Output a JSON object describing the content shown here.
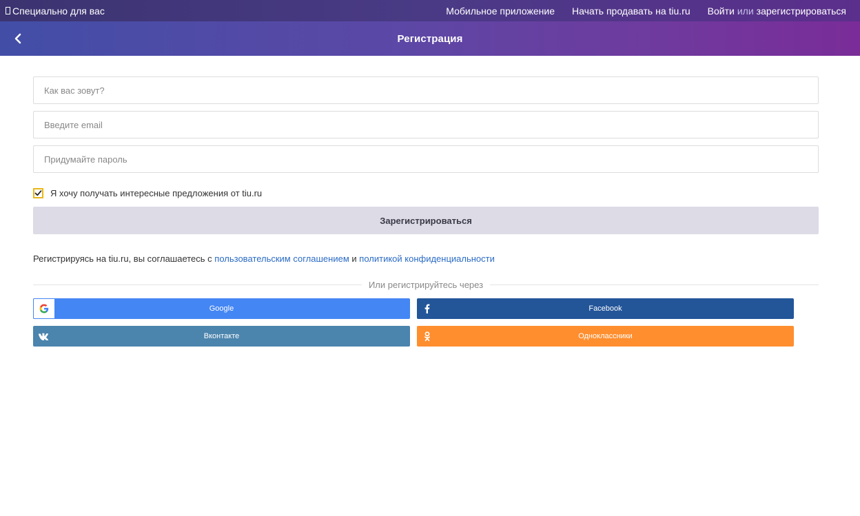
{
  "topbar": {
    "promo_label": "Специально для вас",
    "mobile_app": "Мобильное приложение",
    "start_selling": "Начать продавать на tiu.ru",
    "login": "Войти",
    "or": "или",
    "register": "зарегистрироваться"
  },
  "header": {
    "title": "Регистрация"
  },
  "form": {
    "name_placeholder": "Как вас зовут?",
    "email_placeholder": "Введите email",
    "password_placeholder": "Придумайте пароль",
    "subscribe_label": "Я хочу получать интересные предложения от tiu.ru",
    "subscribe_checked": true,
    "submit_label": "Зарегистрироваться",
    "agreement_prefix": "Регистрируясь на tiu.ru, вы соглашаетесь с ",
    "agreement_link1": "пользовательским соглашением",
    "agreement_and": " и ",
    "agreement_link2": "политикой конфиденциальности"
  },
  "social": {
    "divider_label": "Или регистрируйтесь через",
    "google": "Google",
    "facebook": "Facebook",
    "vk": "Вконтакте",
    "ok": "Одноклассники"
  },
  "colors": {
    "google": "#4486f4",
    "facebook": "#235599",
    "vk": "#4b84ad",
    "ok": "#ff8e2e",
    "checkbox_border": "#e7b81c",
    "link": "#2a6bc4"
  },
  "icons": {
    "back": "chevron-left-icon",
    "checkbox": "checkmark-icon",
    "google": "google-icon",
    "facebook": "facebook-icon",
    "vk": "vk-icon",
    "ok": "odnoklassniki-icon"
  }
}
